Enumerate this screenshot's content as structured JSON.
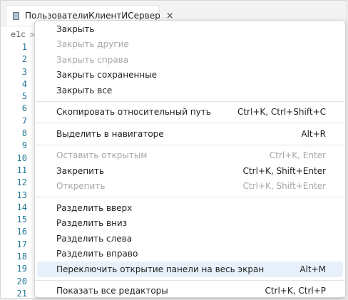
{
  "tab": {
    "title": "ПользователиКлиентИСервер",
    "close": "×"
  },
  "breadcrumb": {
    "root": "e1c",
    "sep": ">"
  },
  "line_numbers": [
    "1",
    "2",
    "3",
    "4",
    "5",
    "6",
    "7",
    "8",
    "9",
    "10",
    "11",
    "12",
    "13",
    "14",
    "15",
    "16",
    "17",
    "18",
    "19",
    "20",
    "21"
  ],
  "menu": {
    "close": "Закрыть",
    "close_others": "Закрыть другие",
    "close_right": "Закрыть справа",
    "close_saved": "Закрыть сохраненные",
    "close_all": "Закрыть все",
    "copy_rel_path": "Скопировать относительный путь",
    "copy_rel_path_kb": "Ctrl+K, Ctrl+Shift+C",
    "reveal_navigator": "Выделить в навигаторе",
    "reveal_navigator_kb": "Alt+R",
    "keep_open": "Оставить открытым",
    "keep_open_kb": "Ctrl+K, Enter",
    "pin": "Закрепить",
    "pin_kb": "Ctrl+K, Shift+Enter",
    "unpin": "Открепить",
    "unpin_kb": "Ctrl+K, Shift+Enter",
    "split_up": "Разделить вверх",
    "split_down": "Разделить вниз",
    "split_left": "Разделить слева",
    "split_right": "Разделить вправо",
    "toggle_maximize": "Переключить открытие панели на весь экран",
    "toggle_maximize_kb": "Alt+M",
    "show_all_editors": "Показать все редакторы",
    "show_all_editors_kb": "Ctrl+K, Ctrl+P"
  },
  "colors": {
    "line_number": "#237893",
    "highlight": "#e8f1fb",
    "disabled": "#a6a6a6"
  }
}
